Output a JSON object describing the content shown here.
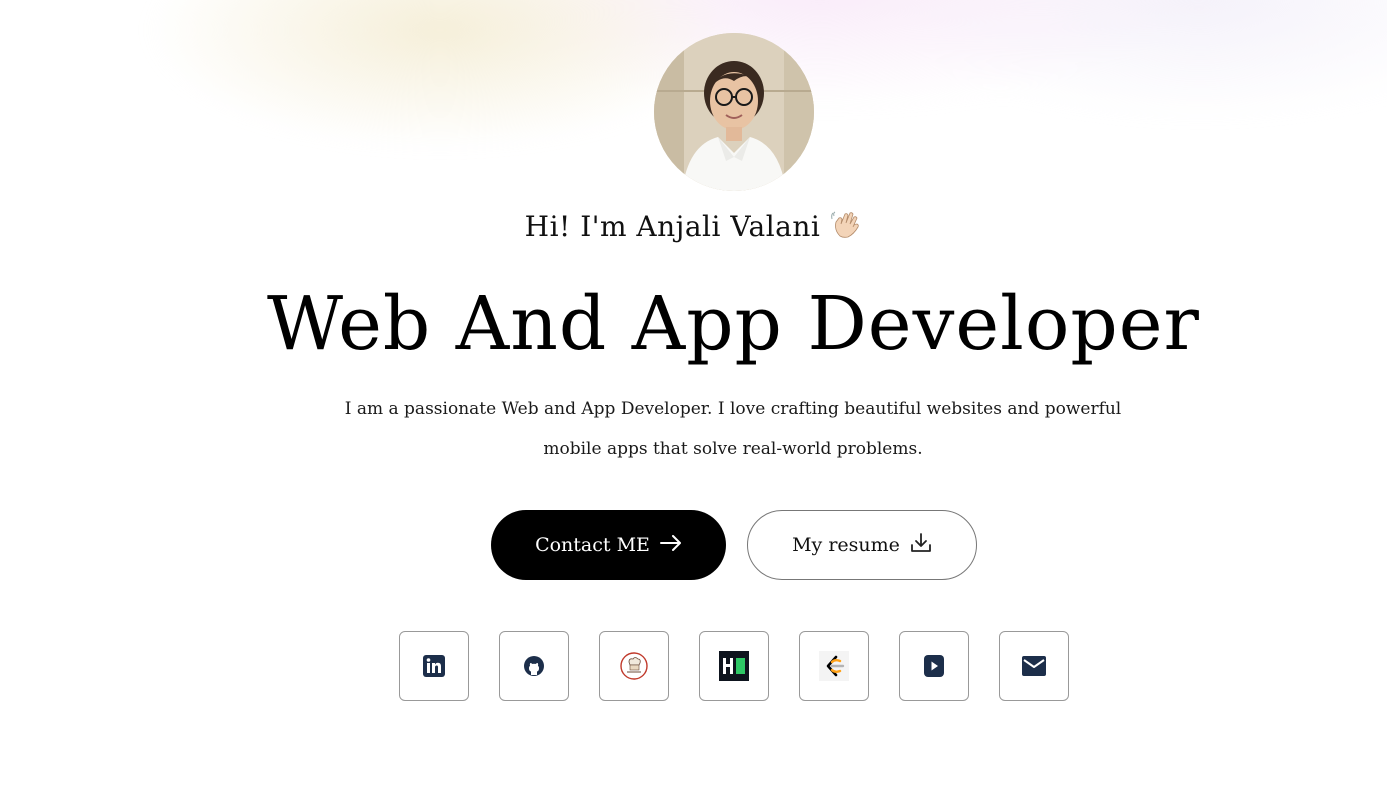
{
  "hero": {
    "greeting": "Hi! I'm Anjali Valani",
    "headline": "Web And App Developer",
    "intro_line1": "I am a passionate Web and App Developer. I love crafting beautiful websites and powerful",
    "intro_line2": "mobile apps that solve real-world problems."
  },
  "actions": {
    "contact_label": "Contact ME",
    "resume_label": "My resume"
  },
  "socials": [
    {
      "name": "linkedin-icon"
    },
    {
      "name": "github-icon"
    },
    {
      "name": "codechef-icon"
    },
    {
      "name": "hackerrank-icon"
    },
    {
      "name": "leetcode-icon"
    },
    {
      "name": "youtube-icon"
    },
    {
      "name": "email-icon"
    }
  ],
  "colors": {
    "primary": "#000000",
    "icon_navy": "#1c2e4a",
    "hackerrank_green": "#2ec866",
    "leetcode_orange": "#ffa116"
  }
}
